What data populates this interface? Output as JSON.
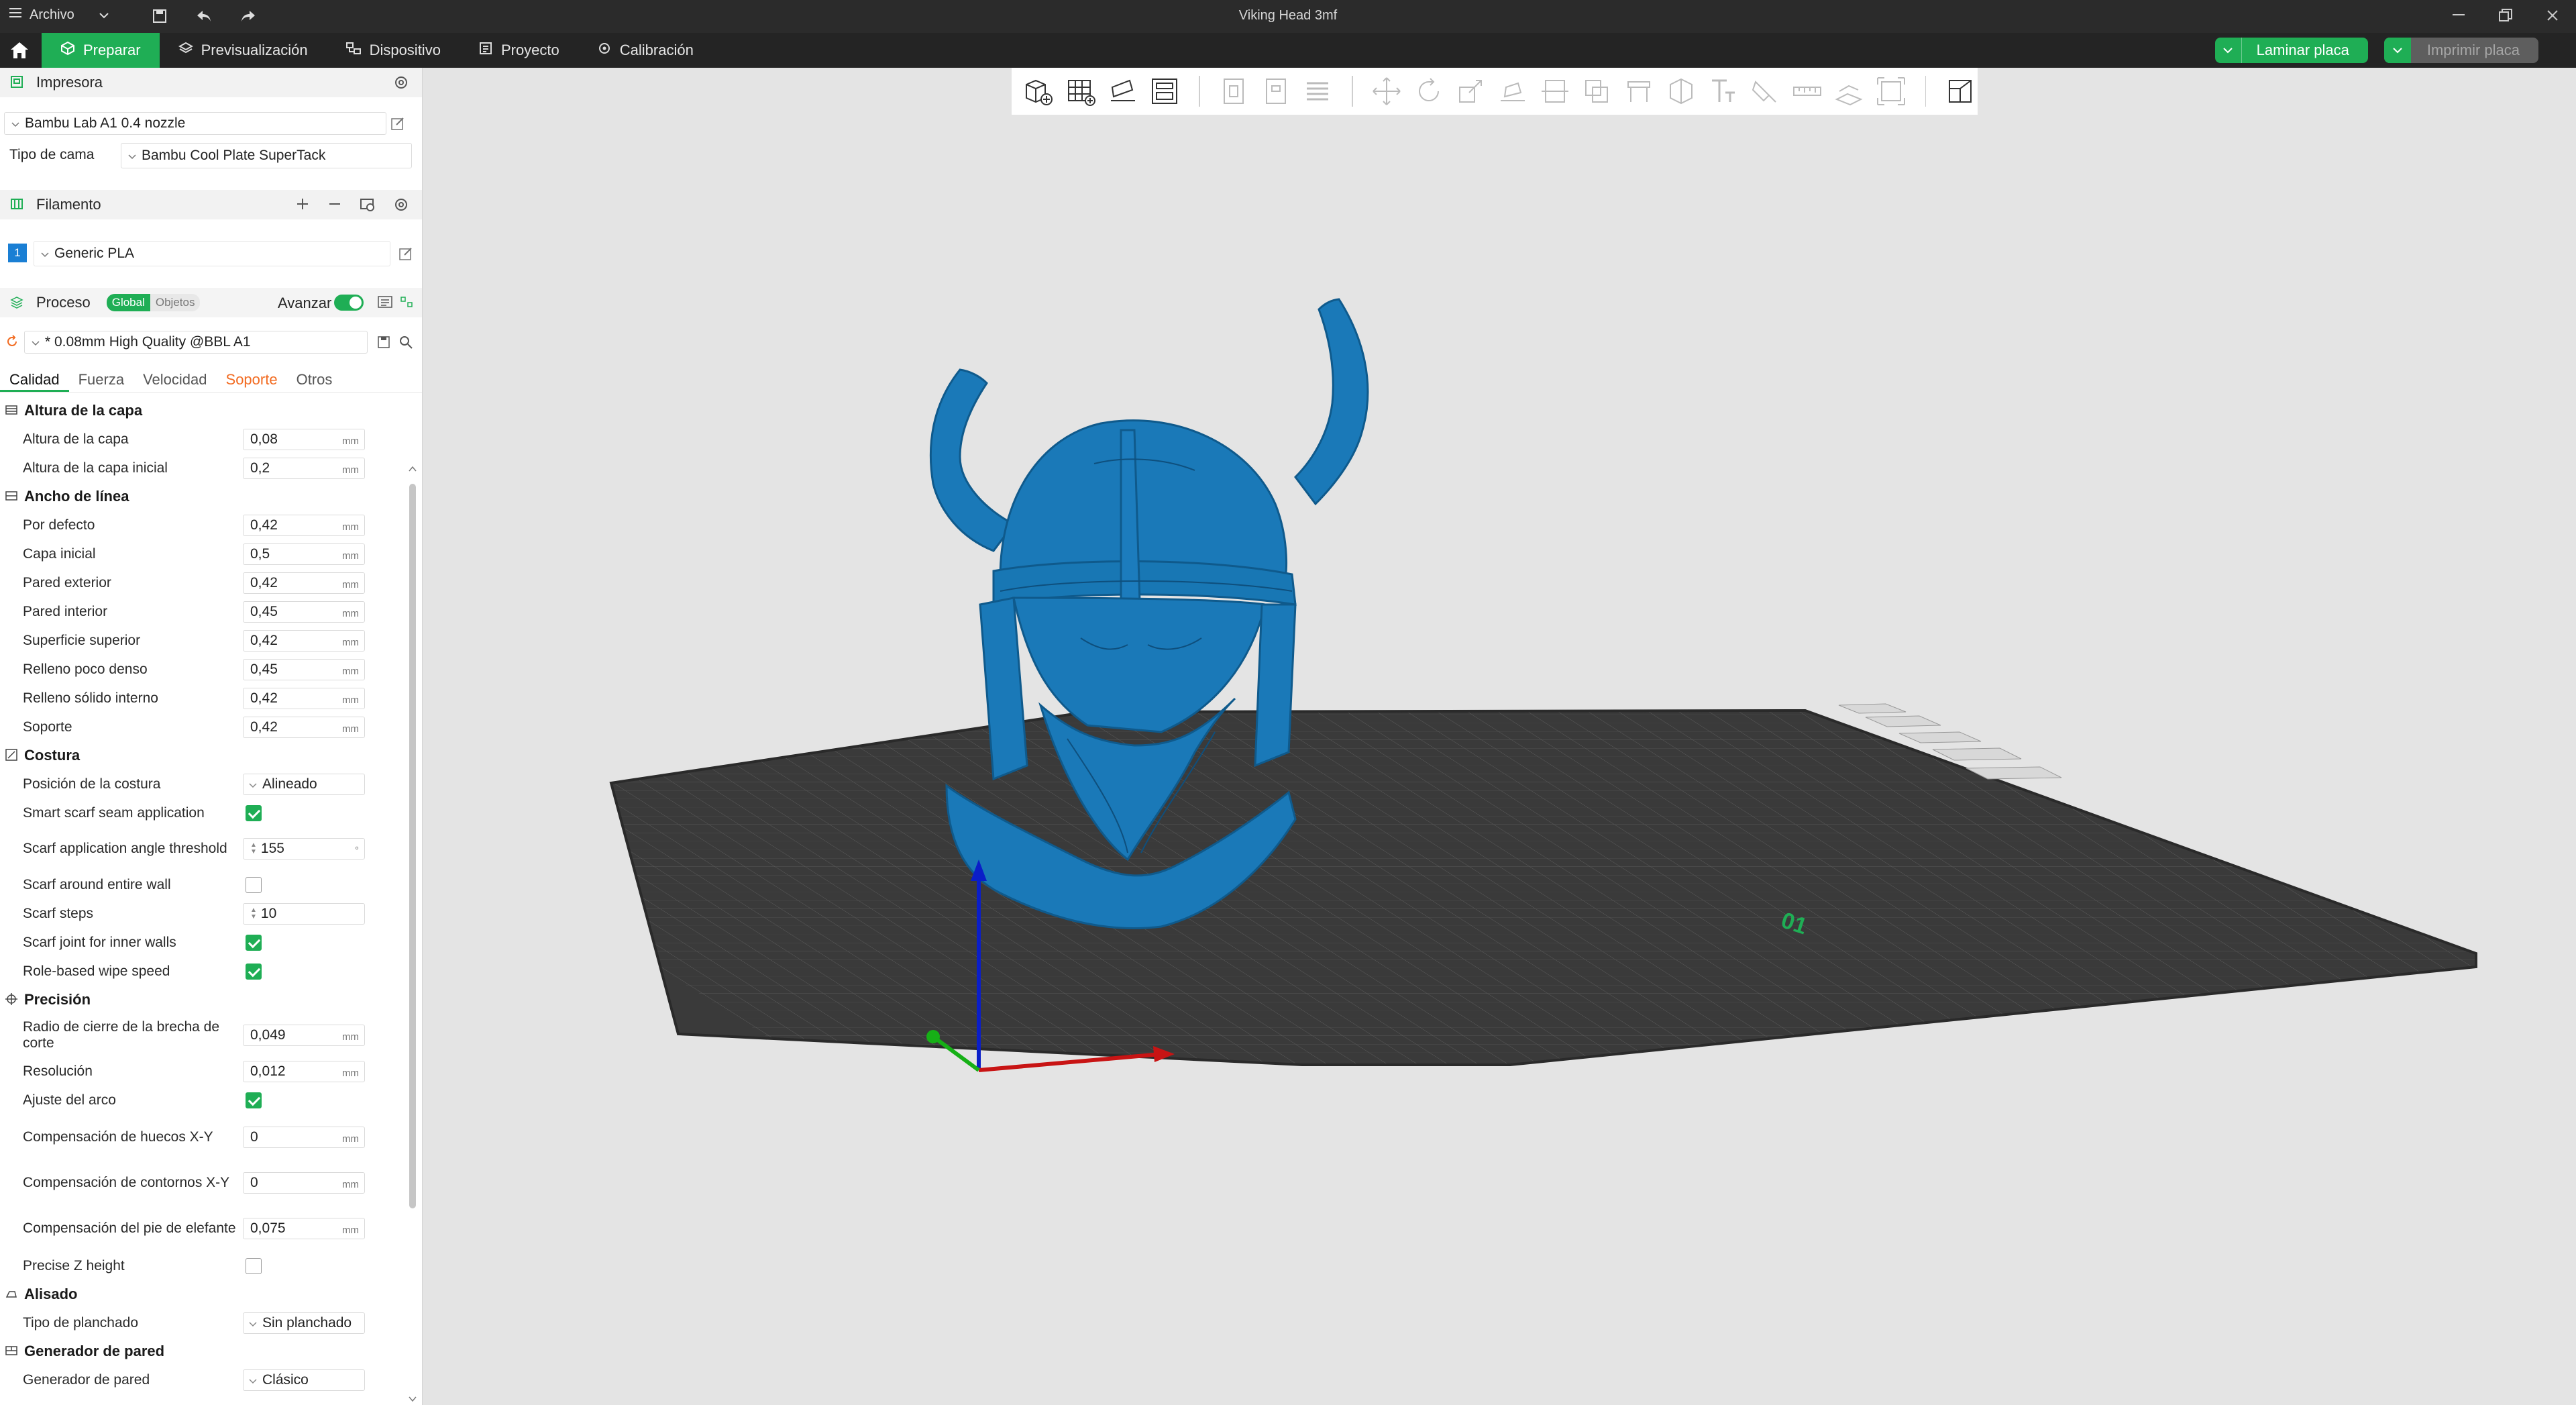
{
  "titlebar": {
    "menu_label": "Archivo",
    "title": "Viking Head 3mf"
  },
  "nav": {
    "tabs": [
      {
        "label": "Preparar",
        "icon": "cube-icon"
      },
      {
        "label": "Previsualización",
        "icon": "layers-icon"
      },
      {
        "label": "Dispositivo",
        "icon": "device-icon"
      },
      {
        "label": "Proyecto",
        "icon": "project-icon"
      },
      {
        "label": "Calibración",
        "icon": "calibration-icon"
      }
    ],
    "slice_button": "Laminar placa",
    "print_button": "Imprimir placa"
  },
  "printer": {
    "section_title": "Impresora",
    "printer_name": "Bambu Lab A1 0.4 nozzle",
    "bed_label": "Tipo de cama",
    "bed_value": "Bambu Cool Plate SuperTack"
  },
  "filament": {
    "section_title": "Filamento",
    "slot_number": "1",
    "slot_color": "#1a7fd4",
    "filament_name": "Generic PLA"
  },
  "process": {
    "section_title": "Proceso",
    "global_label": "Global",
    "objects_label": "Objetos",
    "advance_label": "Avanzar",
    "profile": "* 0.08mm High Quality @BBL A1",
    "tabs": [
      "Calidad",
      "Fuerza",
      "Velocidad",
      "Soporte",
      "Otros"
    ]
  },
  "groups": {
    "layer_height": {
      "title": "Altura de la capa",
      "items": [
        {
          "label": "Altura de la capa",
          "value": "0,08",
          "unit": "mm"
        },
        {
          "label": "Altura de la capa inicial",
          "value": "0,2",
          "unit": "mm"
        }
      ]
    },
    "line_width": {
      "title": "Ancho de línea",
      "items": [
        {
          "label": "Por defecto",
          "value": "0,42",
          "unit": "mm"
        },
        {
          "label": "Capa inicial",
          "value": "0,5",
          "unit": "mm"
        },
        {
          "label": "Pared exterior",
          "value": "0,42",
          "unit": "mm"
        },
        {
          "label": "Pared interior",
          "value": "0,45",
          "unit": "mm"
        },
        {
          "label": "Superficie superior",
          "value": "0,42",
          "unit": "mm"
        },
        {
          "label": "Relleno poco denso",
          "value": "0,45",
          "unit": "mm"
        },
        {
          "label": "Relleno sólido interno",
          "value": "0,42",
          "unit": "mm"
        },
        {
          "label": "Soporte",
          "value": "0,42",
          "unit": "mm"
        }
      ]
    },
    "seam": {
      "title": "Costura",
      "seam_position_label": "Posición de la costura",
      "seam_position_value": "Alineado",
      "smart_scarf_label": "Smart scarf seam application",
      "scarf_angle_label": "Scarf application angle threshold",
      "scarf_angle_value": "155",
      "scarf_angle_unit": "°",
      "scarf_entire_label": "Scarf around entire wall",
      "scarf_steps_label": "Scarf steps",
      "scarf_steps_value": "10",
      "scarf_inner_label": "Scarf joint for inner walls",
      "role_wipe_label": "Role-based wipe speed"
    },
    "precision": {
      "title": "Precisión",
      "gap_close_label": "Radio de cierre de la brecha de corte",
      "gap_close_value": "0,049",
      "resolution_label": "Resolución",
      "resolution_value": "0,012",
      "arc_fit_label": "Ajuste del arco",
      "xy_hole_label": "Compensación de huecos X-Y",
      "xy_hole_value": "0",
      "xy_contour_label": "Compensación de contornos X-Y",
      "xy_contour_value": "0",
      "elephant_label": "Compensación del pie de elefante",
      "elephant_value": "0,075",
      "precise_z_label": "Precise Z height",
      "unit": "mm"
    },
    "ironing": {
      "title": "Alisado",
      "type_label": "Tipo de planchado",
      "type_value": "Sin planchado"
    },
    "wall_gen": {
      "title": "Generador de pared",
      "label": "Generador de pared",
      "value": "Clásico"
    }
  },
  "viewport": {
    "model_color": "#1a79b8",
    "plate_color": "#3a3a3a",
    "plate_number": "01"
  },
  "colors": {
    "accent": "#1fae55",
    "warning_tab": "#f26b21",
    "titlebar_bg": "#2b2b2b"
  }
}
